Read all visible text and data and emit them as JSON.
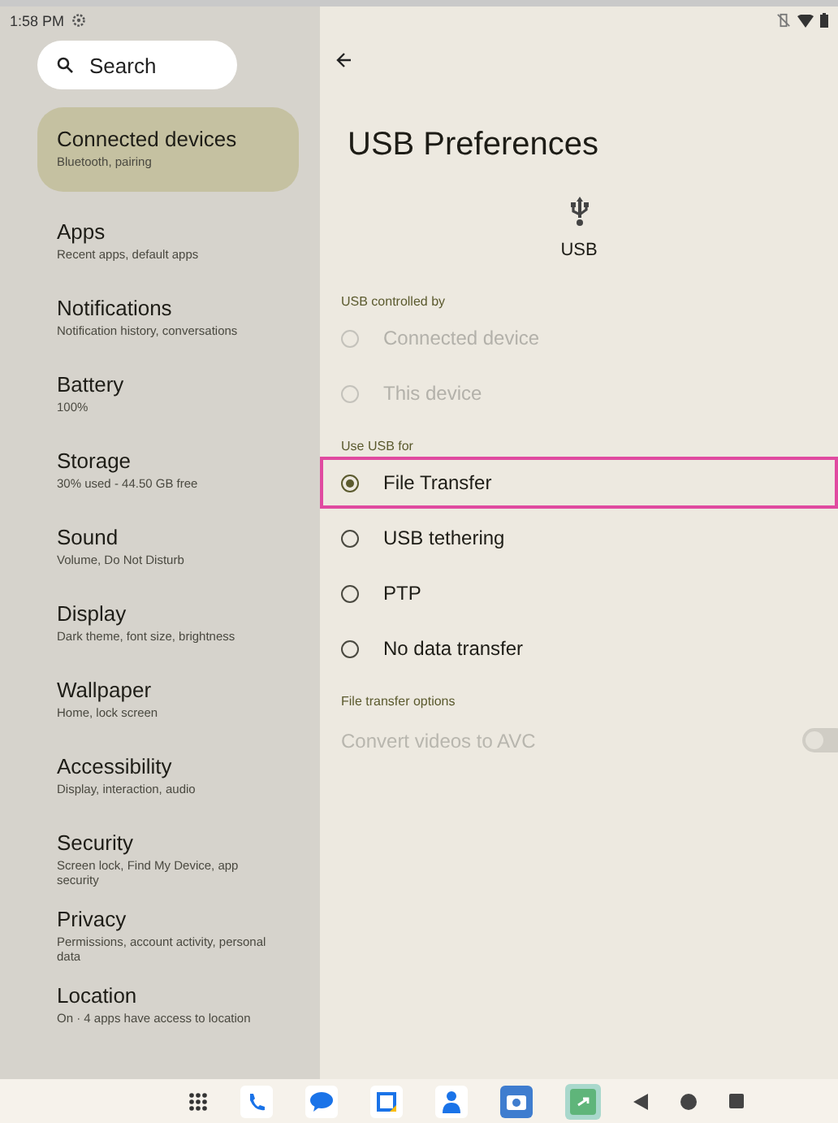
{
  "status_bar": {
    "time": "1:58 PM"
  },
  "search": {
    "placeholder": "Search"
  },
  "sidebar": {
    "items": [
      {
        "title": "Connected devices",
        "subtitle": "Bluetooth, pairing",
        "selected": true
      },
      {
        "title": "Apps",
        "subtitle": "Recent apps, default apps",
        "selected": false
      },
      {
        "title": "Notifications",
        "subtitle": "Notification history, conversations",
        "selected": false
      },
      {
        "title": "Battery",
        "subtitle": "100%",
        "selected": false
      },
      {
        "title": "Storage",
        "subtitle": "30% used - 44.50 GB free",
        "selected": false
      },
      {
        "title": "Sound",
        "subtitle": "Volume, Do Not Disturb",
        "selected": false
      },
      {
        "title": "Display",
        "subtitle": "Dark theme, font size, brightness",
        "selected": false
      },
      {
        "title": "Wallpaper",
        "subtitle": "Home, lock screen",
        "selected": false
      },
      {
        "title": "Accessibility",
        "subtitle": "Display, interaction, audio",
        "selected": false
      },
      {
        "title": "Security",
        "subtitle": "Screen lock, Find My Device, app security",
        "selected": false
      },
      {
        "title": "Privacy",
        "subtitle": "Permissions, account activity, personal data",
        "selected": false
      },
      {
        "title": "Location",
        "subtitle": "On · 4 apps have access to location",
        "selected": false
      }
    ]
  },
  "page": {
    "title": "USB Preferences",
    "icon_label": "USB",
    "sections": [
      {
        "header": "USB controlled by",
        "options": [
          {
            "label": "Connected device",
            "selected": false,
            "disabled": true,
            "highlighted": false
          },
          {
            "label": "This device",
            "selected": false,
            "disabled": true,
            "highlighted": false
          }
        ]
      },
      {
        "header": "Use USB for",
        "options": [
          {
            "label": "File Transfer",
            "selected": true,
            "disabled": false,
            "highlighted": true
          },
          {
            "label": "USB tethering",
            "selected": false,
            "disabled": false,
            "highlighted": false
          },
          {
            "label": "PTP",
            "selected": false,
            "disabled": false,
            "highlighted": false
          },
          {
            "label": "No data transfer",
            "selected": false,
            "disabled": false,
            "highlighted": false
          }
        ]
      }
    ],
    "transfer_options": {
      "header": "File transfer options",
      "toggle": {
        "label": "Convert videos to AVC",
        "on": false,
        "disabled": true
      }
    }
  }
}
